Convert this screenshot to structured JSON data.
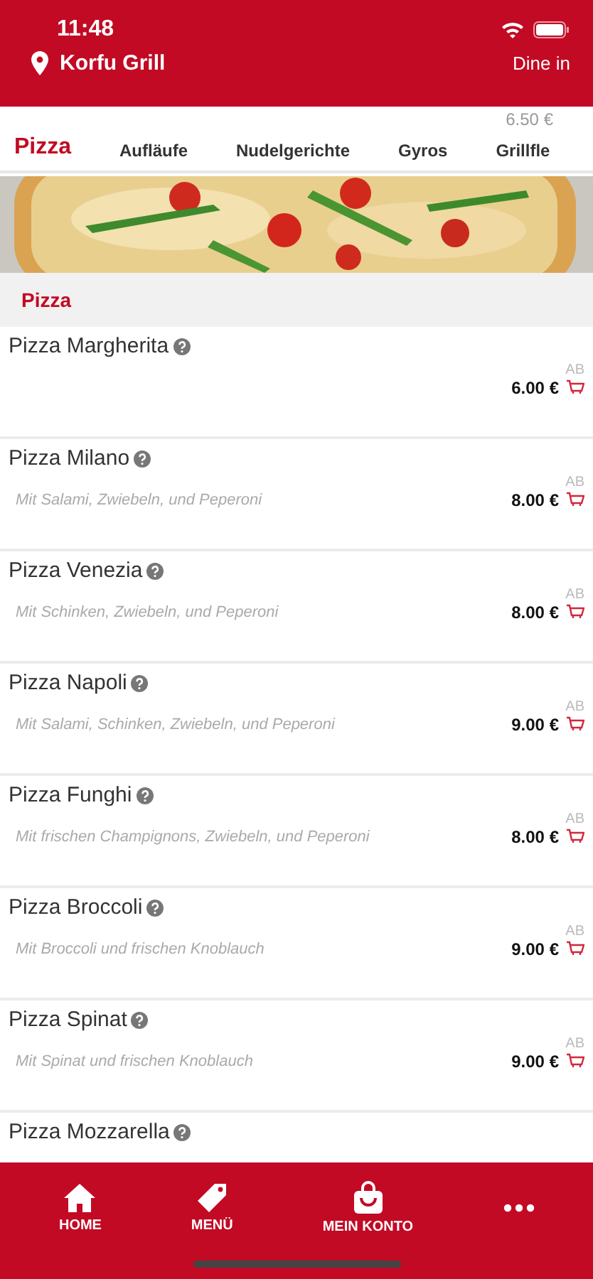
{
  "status_bar": {
    "time": "11:48"
  },
  "header": {
    "location": "Korfu Grill",
    "mode": "Dine in"
  },
  "behind_tabs": {
    "price": "6.50 €"
  },
  "tabs": [
    {
      "label": "Pizza",
      "selected": true
    },
    {
      "label": "Aufläufe",
      "selected": false
    },
    {
      "label": "Nudelgerichte",
      "selected": false
    },
    {
      "label": "Gyros",
      "selected": false
    },
    {
      "label": "Grillfle",
      "selected": false
    }
  ],
  "section": {
    "title": "Pizza"
  },
  "items": [
    {
      "name": "Pizza Margherita",
      "prefix": "AB",
      "price": "6.00 €"
    },
    {
      "name": "Pizza Milano",
      "description": "Mit Salami, Zwiebeln, und Peperoni",
      "prefix": "AB",
      "price": "8.00 €"
    },
    {
      "name": "Pizza Venezia",
      "description": "Mit Schinken, Zwiebeln, und Peperoni",
      "prefix": "AB",
      "price": "8.00 €"
    },
    {
      "name": "Pizza Napoli",
      "description": "Mit Salami, Schinken, Zwiebeln, und Peperoni",
      "prefix": "AB",
      "price": "9.00 €"
    },
    {
      "name": "Pizza Funghi",
      "description": "Mit frischen Champignons, Zwiebeln, und Peperoni",
      "prefix": "AB",
      "price": "8.00 €"
    },
    {
      "name": "Pizza Broccoli",
      "description": "Mit Broccoli und frischen Knoblauch",
      "prefix": "AB",
      "price": "9.00 €"
    },
    {
      "name": "Pizza Spinat",
      "description": "Mit Spinat und frischen Knoblauch",
      "prefix": "AB",
      "price": "9.00 €"
    },
    {
      "name": "Pizza Mozzarella"
    }
  ],
  "nav": [
    {
      "kind": "home",
      "label": "HOME"
    },
    {
      "kind": "tag",
      "label": "MENÜ"
    },
    {
      "kind": "bag",
      "label": "MEIN KONTO"
    },
    {
      "kind": "more"
    }
  ]
}
